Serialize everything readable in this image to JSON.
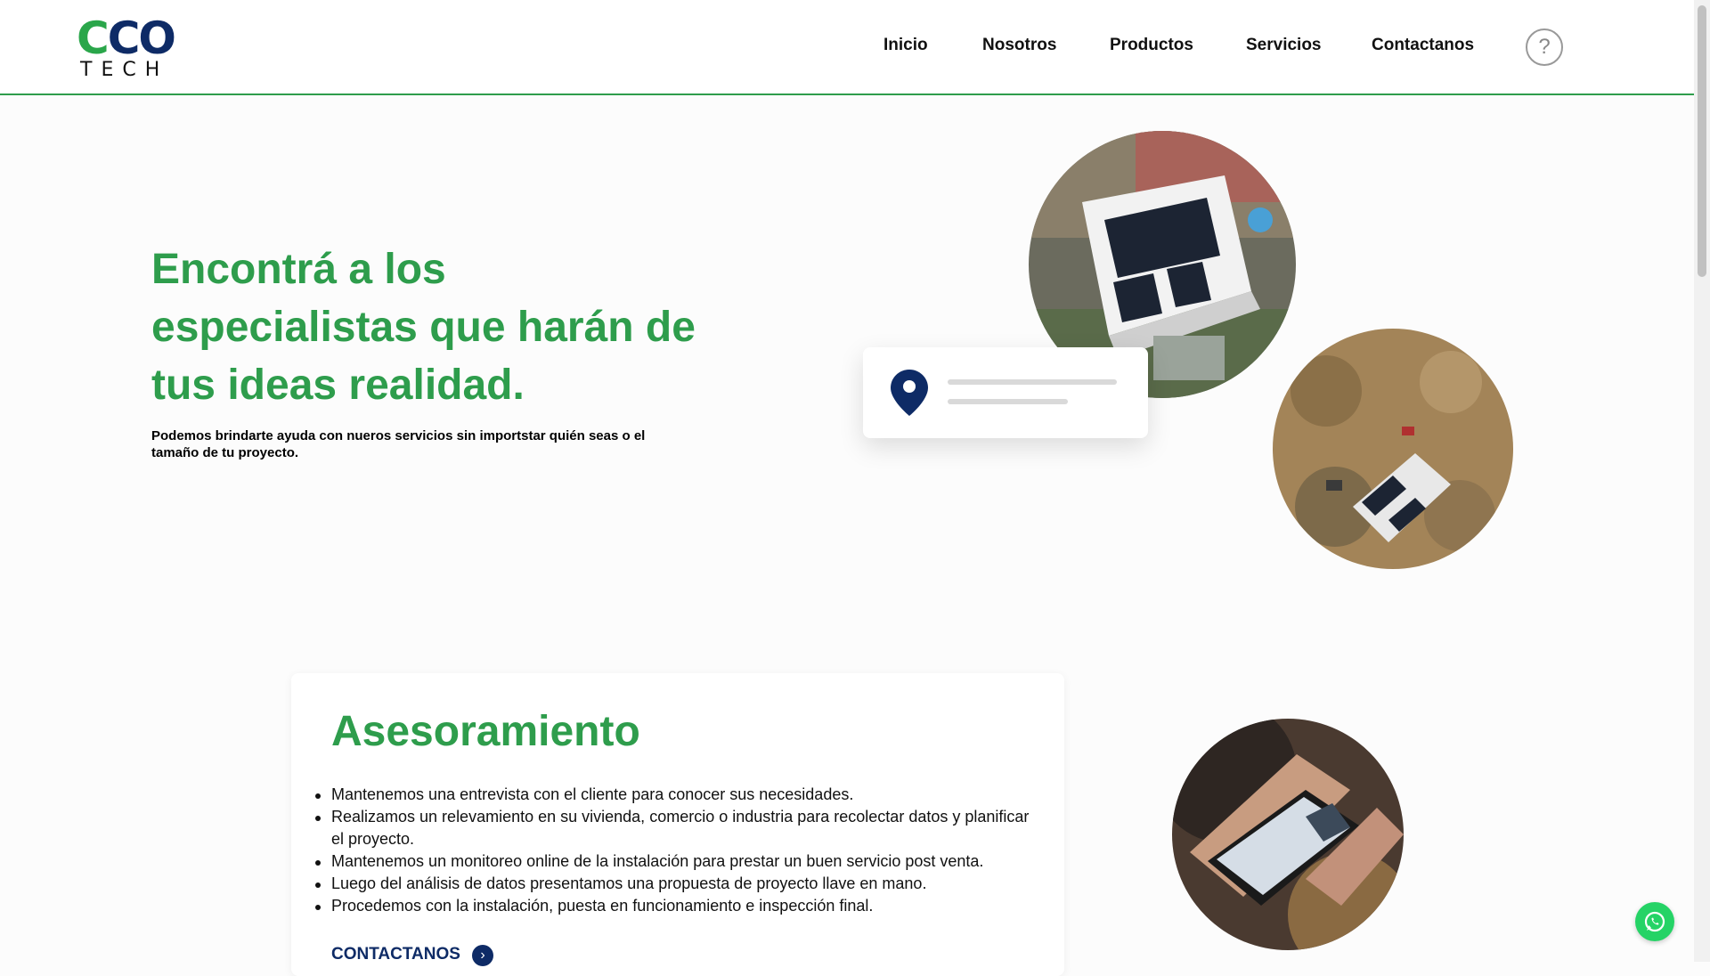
{
  "logo": {
    "top": "CO",
    "e": "C",
    "bottom": "TECH"
  },
  "nav": {
    "items": [
      "Inicio",
      "Nosotros",
      "Productos",
      "Servicios",
      "Contactanos"
    ],
    "help": "?"
  },
  "hero": {
    "title": "Encontrá a los especialistas que harán de tus ideas realidad.",
    "subtitle": "Podemos brindarte ayuda con nueros servicios sin importstar quién seas o el tamaño de tu proyecto."
  },
  "service": {
    "title": "Asesoramiento",
    "items": [
      "Mantenemos una entrevista con el cliente para conocer sus necesidades.",
      "Realizamos un relevamiento en su vivienda, comercio o industria para recolectar datos y planificar el proyecto.",
      "Mantenemos un monitoreo online de la instalación para prestar un buen servicio post venta.",
      "Luego del análisis de datos presentamos una propuesta de proyecto llave en mano.",
      "Procedemos con la instalación, puesta en funcionamiento e inspección final."
    ],
    "link": "CONTACTANOS",
    "arrow": "›"
  },
  "colors": {
    "accent_green": "#2e9d4c",
    "navy": "#0e2b66",
    "whatsapp": "#25d366"
  },
  "icons": [
    "question-icon",
    "location-pin-icon",
    "chevron-right-icon",
    "whatsapp-icon"
  ]
}
